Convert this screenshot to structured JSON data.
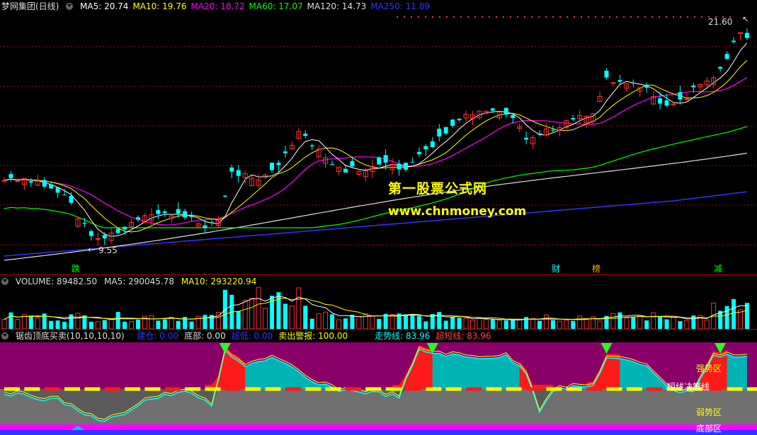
{
  "main": {
    "title": "梦网集团(日线)",
    "ma": [
      {
        "label": "MA5: 20.74",
        "color": "#ffffff"
      },
      {
        "label": "MA10: 19.76",
        "color": "#ffff00"
      },
      {
        "label": "MA20: 18.72",
        "color": "#ff00ff"
      },
      {
        "label": "MA60: 17.07",
        "color": "#00ff00"
      },
      {
        "label": "MA120: 14.73",
        "color": "#dddddd"
      },
      {
        "label": "MA250: 11.89",
        "color": "#3333ff"
      }
    ],
    "high_label": "21.60",
    "low_label": "9.55",
    "events": {
      "die": "跌",
      "cai": "财",
      "bang": "榜",
      "jian": "减"
    },
    "watermark_cn": "第一股票公式网",
    "watermark_url": "www.chnmoney.com"
  },
  "volume": {
    "label": "VOLUME: 89482.50",
    "ma5": "MA5: 290045.78",
    "ma10": "MA10: 293220.94"
  },
  "indicator": {
    "title": "锯齿顶底买卖(10,10,10,10)",
    "items": [
      {
        "label": "建仓: 0.00",
        "color": "#3333ff"
      },
      {
        "label": "底部: 0.00",
        "color": "#dddddd"
      },
      {
        "label": "超低: 0.00",
        "color": "#3333ff"
      },
      {
        "label": "卖出警报: 100.00",
        "color": "#ffff00"
      },
      {
        "label": "走势线: 83.96",
        "color": "#00ffff"
      },
      {
        "label": "超短线: 83.96",
        "color": "#ff4444"
      }
    ],
    "zones": {
      "strong": "强势区",
      "decision": "短线决策线",
      "weak": "弱势区",
      "bottom": "底部区"
    }
  },
  "colors": {
    "up": "#ff3232",
    "down": "#00ffff",
    "grid": "#b00000"
  }
}
